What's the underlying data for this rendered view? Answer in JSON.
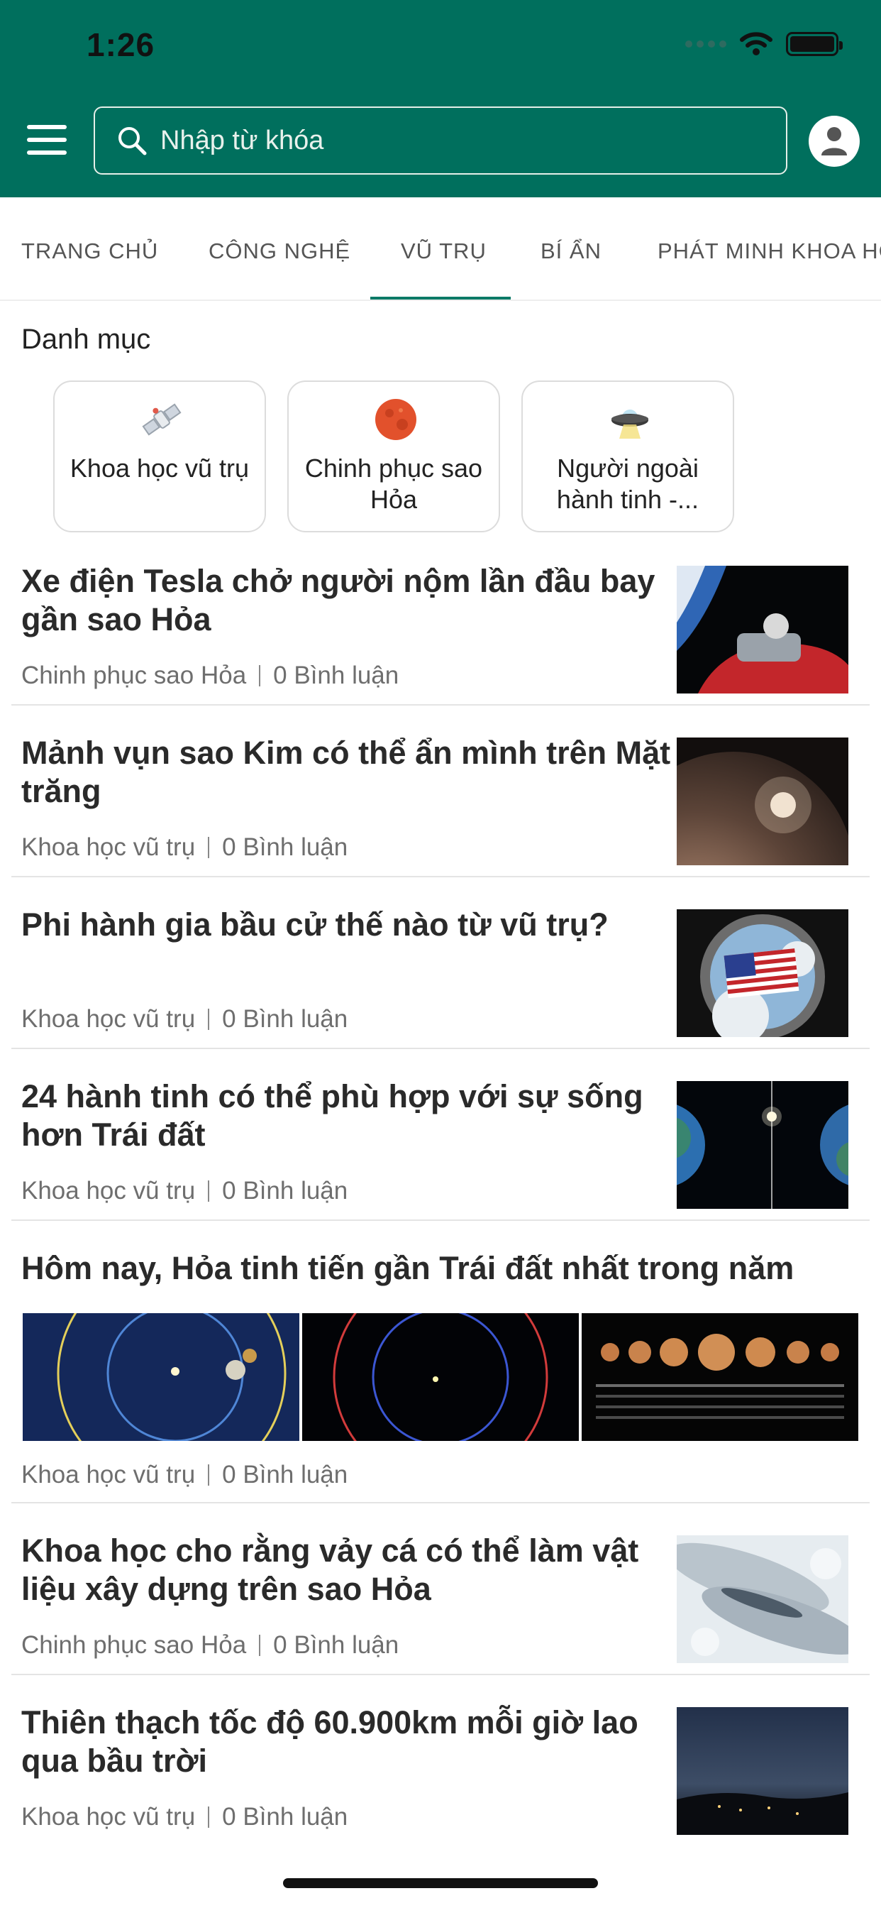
{
  "status": {
    "time": "1:26"
  },
  "search": {
    "placeholder": "Nhập từ khóa"
  },
  "tabs": [
    {
      "label": "TRANG CHỦ"
    },
    {
      "label": "CÔNG NGHỆ"
    },
    {
      "label": "VŨ TRỤ"
    },
    {
      "label": "BÍ ẨN"
    },
    {
      "label": "PHÁT MINH KHOA HỌ"
    }
  ],
  "active_tab": "VŨ TRỤ",
  "categories": {
    "title": "Danh mục",
    "items": [
      {
        "label": "Khoa học vũ trụ",
        "icon": "satellite-icon"
      },
      {
        "label": "Chinh phục sao Hỏa",
        "icon": "mars-icon"
      },
      {
        "label": "Người ngoài hành tinh -...",
        "icon": "ufo-icon"
      }
    ]
  },
  "articles": [
    {
      "title": "Xe điện Tesla chở người nộm lần đầu bay gần sao Hỏa",
      "category": "Chinh phục sao Hỏa",
      "comments": "0 Bình luận"
    },
    {
      "title": "Mảnh vụn sao Kim có thể ẩn mình trên Mặt trăng",
      "category": "Khoa học vũ trụ",
      "comments": "0 Bình luận"
    },
    {
      "title": "Phi hành gia bầu cử thế nào từ vũ trụ?",
      "category": "Khoa học vũ trụ",
      "comments": "0 Bình luận"
    },
    {
      "title": "24 hành tinh có thể phù hợp với sự sống hơn Trái đất",
      "category": "Khoa học vũ trụ",
      "comments": "0 Bình luận"
    },
    {
      "title": "Hôm nay, Hỏa tinh tiến gần Trái đất nhất trong năm",
      "category": "Khoa học vũ trụ",
      "comments": "0 Bình luận"
    },
    {
      "title": "Khoa học cho rằng vảy cá có thể làm vật liệu xây dựng trên sao Hỏa",
      "category": "Chinh phục sao Hỏa",
      "comments": "0 Bình luận"
    },
    {
      "title": "Thiên thạch tốc độ 60.900km mỗi giờ lao qua bầu trời",
      "category": "Khoa học vũ trụ",
      "comments": "0 Bình luận"
    }
  ],
  "colors": {
    "header": "#006f5d",
    "accent": "#0c7a67"
  }
}
